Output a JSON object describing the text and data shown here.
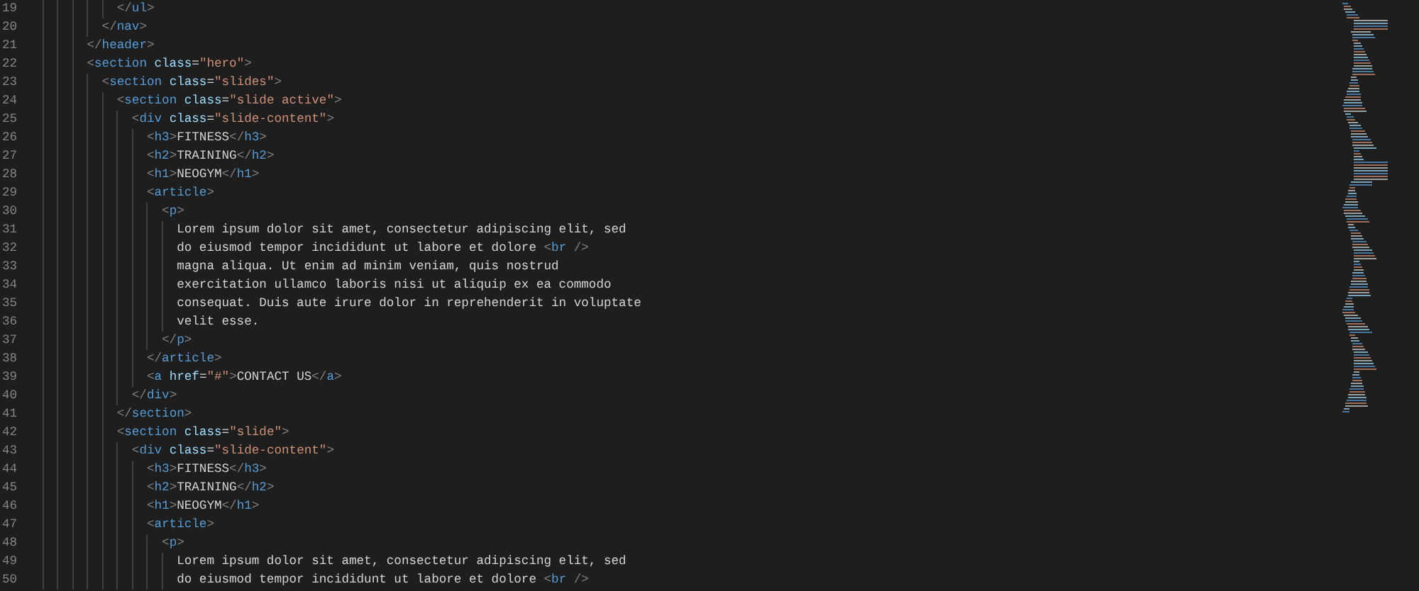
{
  "editor": {
    "lines": [
      {
        "number": "19",
        "text": "            </ul>"
      },
      {
        "number": "20",
        "text": "          </nav>"
      },
      {
        "number": "21",
        "text": "        </header>"
      },
      {
        "number": "22",
        "text": "        <section class=\"hero\">"
      },
      {
        "number": "23",
        "text": "          <section class=\"slides\">"
      },
      {
        "number": "24",
        "text": "            <section class=\"slide active\">"
      },
      {
        "number": "25",
        "text": "              <div class=\"slide-content\">"
      },
      {
        "number": "26",
        "text": "                <h3>FITNESS</h3>"
      },
      {
        "number": "27",
        "text": "                <h2>TRAINING</h2>"
      },
      {
        "number": "28",
        "text": "                <h1>NEOGYM</h1>"
      },
      {
        "number": "29",
        "text": "                <article>"
      },
      {
        "number": "30",
        "text": "                  <p>"
      },
      {
        "number": "31",
        "text": "                    Lorem ipsum dolor sit amet, consectetur adipiscing elit, sed"
      },
      {
        "number": "32",
        "text": "                    do eiusmod tempor incididunt ut labore et dolore <br />"
      },
      {
        "number": "33",
        "text": "                    magna aliqua. Ut enim ad minim veniam, quis nostrud"
      },
      {
        "number": "34",
        "text": "                    exercitation ullamco laboris nisi ut aliquip ex ea commodo"
      },
      {
        "number": "35",
        "text": "                    consequat. Duis aute irure dolor in reprehenderit in voluptate"
      },
      {
        "number": "36",
        "text": "                    velit esse."
      },
      {
        "number": "37",
        "text": "                  </p>"
      },
      {
        "number": "38",
        "text": "                </article>"
      },
      {
        "number": "39",
        "text": "                <a href=\"#\">CONTACT US</a>"
      },
      {
        "number": "40",
        "text": "              </div>"
      },
      {
        "number": "41",
        "text": "            </section>"
      },
      {
        "number": "42",
        "text": "            <section class=\"slide\">"
      },
      {
        "number": "43",
        "text": "              <div class=\"slide-content\">"
      },
      {
        "number": "44",
        "text": "                <h3>FITNESS</h3>"
      },
      {
        "number": "45",
        "text": "                <h2>TRAINING</h2>"
      },
      {
        "number": "46",
        "text": "                <h1>NEOGYM</h1>"
      },
      {
        "number": "47",
        "text": "                <article>"
      },
      {
        "number": "48",
        "text": "                  <p>"
      },
      {
        "number": "49",
        "text": "                    Lorem ipsum dolor sit amet, consectetur adipiscing elit, sed"
      },
      {
        "number": "50",
        "text": "                    do eiusmod tempor incididunt ut labore et dolore <br />"
      }
    ]
  }
}
